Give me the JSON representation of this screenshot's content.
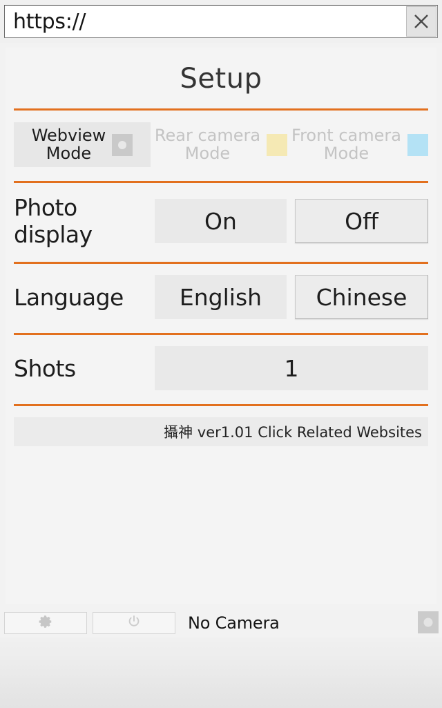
{
  "browser": {
    "url_value": "https://",
    "url_placeholder": "https://",
    "clear_label": "X"
  },
  "page": {
    "title": "Setup",
    "accent_color": "#e2701e",
    "panel_bg": "#f4f4f4"
  },
  "mode_row": {
    "options": [
      {
        "label": "Webview\nMode",
        "state": "active",
        "swatch_color": "#c9c9c9",
        "swatch_dot_color": "#e8e8e8",
        "has_dot": true
      },
      {
        "label": "Rear camera\nMode",
        "state": "inactive",
        "swatch_color": "#f5e9b4",
        "swatch_dot_color": "",
        "has_dot": false
      },
      {
        "label": "Front camera\nMode",
        "state": "inactive",
        "swatch_color": "#b4e2f5",
        "swatch_dot_color": "",
        "has_dot": false
      }
    ]
  },
  "settings": [
    {
      "label": "Photo display",
      "buttons": [
        {
          "label": "On",
          "selected": false
        },
        {
          "label": "Off",
          "selected": true
        }
      ]
    },
    {
      "label": "Language",
      "buttons": [
        {
          "label": "English",
          "selected": false
        },
        {
          "label": "Chinese",
          "selected": true
        }
      ]
    }
  ],
  "shots": {
    "label": "Shots",
    "value": "1"
  },
  "version_bar": {
    "text": "攝神 ver1.01   Click Related Websites"
  },
  "toolbar": {
    "settings_icon": "gear-icon",
    "power_icon": "power-icon",
    "status": "No Camera",
    "right_swatch_color": "#cbcbcb"
  }
}
